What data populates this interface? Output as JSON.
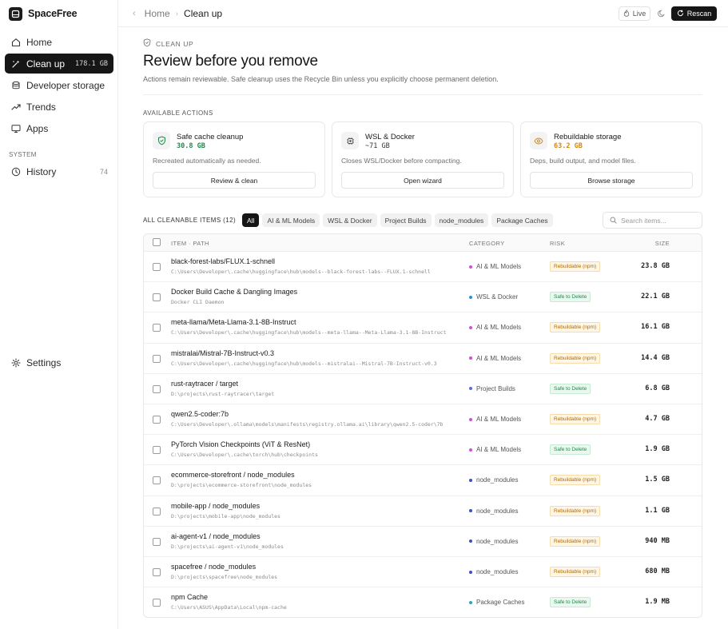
{
  "app": {
    "name": "SpaceFree"
  },
  "sidebar": {
    "items": [
      {
        "label": "Home",
        "icon": "home-icon"
      },
      {
        "label": "Clean up",
        "icon": "sparkles-icon",
        "badge": "178.1 GB",
        "active": true
      },
      {
        "label": "Developer storage",
        "icon": "database-icon"
      },
      {
        "label": "Trends",
        "icon": "trend-icon"
      },
      {
        "label": "Apps",
        "icon": "monitor-icon"
      }
    ],
    "system_label": "SYSTEM",
    "history": {
      "label": "History",
      "count": "74"
    },
    "settings": {
      "label": "Settings"
    }
  },
  "topbar": {
    "breadcrumb": [
      "Home",
      "Clean up"
    ],
    "live_label": "Live",
    "rescan_label": "Rescan"
  },
  "header": {
    "eyebrow": "CLEAN UP",
    "title": "Review before you remove",
    "subtitle": "Actions remain reviewable. Safe cleanup uses the Recycle Bin unless you explicitly choose permanent deletion."
  },
  "actions": {
    "label": "AVAILABLE ACTIONS",
    "cards": [
      {
        "title": "Safe cache cleanup",
        "size": "30.8 GB",
        "size_color": "#1f8a4a",
        "desc": "Recreated automatically as needed.",
        "button": "Review & clean",
        "icon": "shield-check-icon",
        "icon_color": "#1f8a4a"
      },
      {
        "title": "WSL & Docker",
        "size": "~71 GB",
        "size_color": "#333333",
        "desc": "Closes WSL/Docker before compacting.",
        "button": "Open wizard",
        "icon": "chip-icon",
        "icon_color": "#555555"
      },
      {
        "title": "Rebuildable storage",
        "size": "63.2 GB",
        "size_color": "#d4880f",
        "desc": "Deps, build output, and model files.",
        "button": "Browse storage",
        "icon": "eye-icon",
        "icon_color": "#d4880f"
      }
    ]
  },
  "filters": {
    "label": "ALL CLEANABLE ITEMS (12)",
    "chips": [
      "All",
      "AI & ML Models",
      "WSL & Docker",
      "Project Builds",
      "node_modules",
      "Package Caches"
    ],
    "search_placeholder": "Search items..."
  },
  "table": {
    "headers": {
      "item": "ITEM · PATH",
      "category": "CATEGORY",
      "risk": "RISK",
      "size": "SIZE"
    },
    "rows": [
      {
        "name": "black-forest-labs/FLUX.1-schnell",
        "path": "C:\\Users\\Developer\\.cache\\huggingface\\hub\\models--black-forest-labs--FLUX.1-schnell",
        "category": "AI & ML Models",
        "dot": "#d14fd1",
        "risk": "Rebuildable (npm)",
        "risk_type": "rebuild",
        "size": "23.8 GB"
      },
      {
        "name": "Docker Build Cache & Dangling Images",
        "path": "Docker CLI Daemon",
        "category": "WSL & Docker",
        "dot": "#2a8fd8",
        "risk": "Safe to Delete",
        "risk_type": "safe",
        "size": "22.1 GB"
      },
      {
        "name": "meta-llama/Meta-Llama-3.1-8B-Instruct",
        "path": "C:\\Users\\Developer\\.cache\\huggingface\\hub\\models--meta-llama--Meta-Llama-3.1-8B-Instruct",
        "category": "AI & ML Models",
        "dot": "#d14fd1",
        "risk": "Rebuildable (npm)",
        "risk_type": "rebuild",
        "size": "16.1 GB"
      },
      {
        "name": "mistralai/Mistral-7B-Instruct-v0.3",
        "path": "C:\\Users\\Developer\\.cache\\huggingface\\hub\\models--mistralai--Mistral-7B-Instruct-v0.3",
        "category": "AI & ML Models",
        "dot": "#d14fd1",
        "risk": "Rebuildable (npm)",
        "risk_type": "rebuild",
        "size": "14.4 GB"
      },
      {
        "name": "rust-raytracer / target",
        "path": "D:\\projects\\rust-raytracer\\target",
        "category": "Project Builds",
        "dot": "#5a6de0",
        "risk": "Safe to Delete",
        "risk_type": "safe",
        "size": "6.8 GB"
      },
      {
        "name": "qwen2.5-coder:7b",
        "path": "C:\\Users\\Developer\\.ollama\\models\\manifests\\registry.ollama.ai\\library\\qwen2.5-coder\\7b",
        "category": "AI & ML Models",
        "dot": "#d14fd1",
        "risk": "Rebuildable (npm)",
        "risk_type": "rebuild",
        "size": "4.7 GB"
      },
      {
        "name": "PyTorch Vision Checkpoints (ViT & ResNet)",
        "path": "C:\\Users\\Developer\\.cache\\torch\\hub\\checkpoints",
        "category": "AI & ML Models",
        "dot": "#d14fd1",
        "risk": "Safe to Delete",
        "risk_type": "safe",
        "size": "1.9 GB"
      },
      {
        "name": "ecommerce-storefront / node_modules",
        "path": "D:\\projects\\ecommerce-storefront\\node_modules",
        "category": "node_modules",
        "dot": "#3a4fc8",
        "risk": "Rebuildable (npm)",
        "risk_type": "rebuild",
        "size": "1.5 GB"
      },
      {
        "name": "mobile-app / node_modules",
        "path": "D:\\projects\\mobile-app\\node_modules",
        "category": "node_modules",
        "dot": "#3a4fc8",
        "risk": "Rebuildable (npm)",
        "risk_type": "rebuild",
        "size": "1.1 GB"
      },
      {
        "name": "ai-agent-v1 / node_modules",
        "path": "D:\\projects\\ai-agent-v1\\node_modules",
        "category": "node_modules",
        "dot": "#3a4fc8",
        "risk": "Rebuildable (npm)",
        "risk_type": "rebuild",
        "size": "940 MB"
      },
      {
        "name": "spacefree / node_modules",
        "path": "D:\\projects\\spacefree\\node_modules",
        "category": "node_modules",
        "dot": "#3a4fc8",
        "risk": "Rebuildable (npm)",
        "risk_type": "rebuild",
        "size": "680 MB"
      },
      {
        "name": "npm Cache",
        "path": "C:\\Users\\ASUS\\AppData\\Local\\npm-cache",
        "category": "Package Caches",
        "dot": "#2aa8b8",
        "risk": "Safe to Delete",
        "risk_type": "safe",
        "size": "1.9 MB"
      }
    ]
  }
}
